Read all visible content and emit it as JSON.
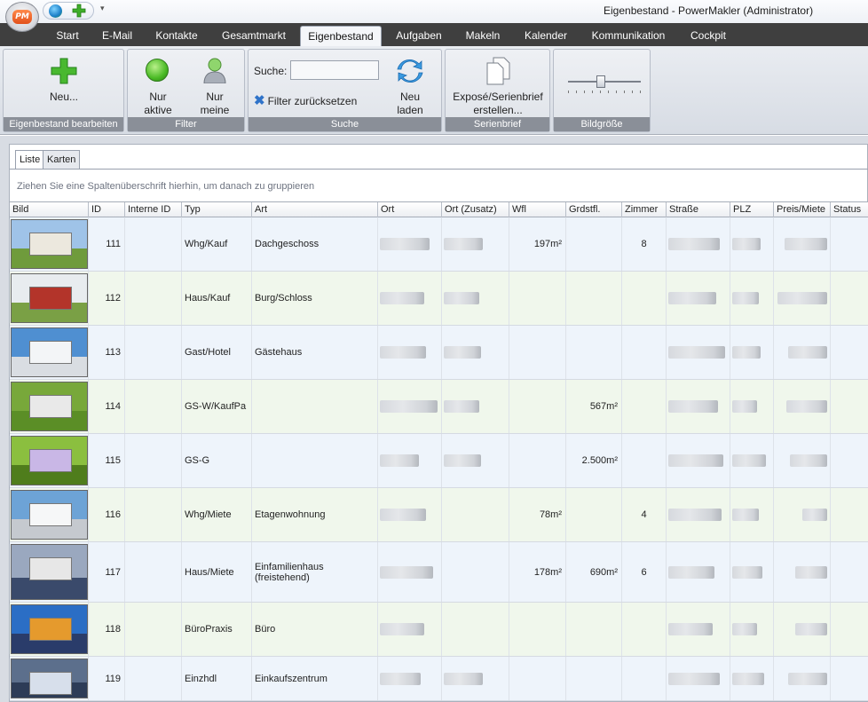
{
  "window": {
    "title": "Eigenbestand - PowerMakler (Administrator)",
    "logo_text": "PM"
  },
  "qat": {
    "icons": [
      "globe-icon",
      "plus-icon"
    ],
    "dropdown": "▾"
  },
  "tabs": [
    "Start",
    "E-Mail",
    "Kontakte",
    "Gesamtmarkt",
    "Eigenbestand",
    "Aufgaben",
    "Makeln",
    "Kalender",
    "Kommunikation",
    "Cockpit"
  ],
  "active_tab": "Eigenbestand",
  "ribbon": {
    "groups": {
      "eigenbestand": {
        "caption": "Eigenbestand bearbeiten",
        "new_label": "Neu..."
      },
      "filter": {
        "caption": "Filter",
        "active_label_1": "Nur",
        "active_label_2": "aktive",
        "mine_label_1": "Nur",
        "mine_label_2": "meine"
      },
      "suche": {
        "caption": "Suche",
        "search_label": "Suche:",
        "search_value": "",
        "reset_label": "Filter zurücksetzen",
        "reload_label_1": "Neu",
        "reload_label_2": "laden"
      },
      "serienbrief": {
        "caption": "Serienbrief",
        "expose_label_1": "Exposé/Serienbrief",
        "expose_label_2": "erstellen..."
      },
      "bildgroesse": {
        "caption": "Bildgröße",
        "value": 0.45
      }
    }
  },
  "view_tabs": [
    "Liste",
    "Karten"
  ],
  "group_hint": "Ziehen Sie eine Spaltenüberschrift hierhin, um danach zu gruppieren",
  "columns": [
    "Bild",
    "ID",
    "Interne ID",
    "Typ",
    "Art",
    "Ort",
    "Ort (Zusatz)",
    "Wfl",
    "Grdstfl.",
    "Zimmer",
    "Straße",
    "PLZ",
    "Preis/Miete",
    "Status"
  ],
  "rows": [
    {
      "id": "111",
      "interne_id": "",
      "typ": "Whg/Kauf",
      "art": "Dachgeschoss",
      "wfl": "197m²",
      "grdstfl": "",
      "zimmer": "8",
      "thumb": "apartment-house"
    },
    {
      "id": "112",
      "interne_id": "",
      "typ": "Haus/Kauf",
      "art": "Burg/Schloss",
      "wfl": "",
      "grdstfl": "",
      "zimmer": "",
      "thumb": "modern-house"
    },
    {
      "id": "113",
      "interne_id": "",
      "typ": "Gast/Hotel",
      "art": "Gästehaus",
      "wfl": "",
      "grdstfl": "",
      "zimmer": "",
      "thumb": "high-rise"
    },
    {
      "id": "114",
      "interne_id": "",
      "typ": "GS-W/KaufPa",
      "art": "",
      "wfl": "",
      "grdstfl": "567m²",
      "zimmer": "",
      "thumb": "garden"
    },
    {
      "id": "115",
      "interne_id": "",
      "typ": "GS-G",
      "art": "",
      "wfl": "",
      "grdstfl": "2.500m²",
      "zimmer": "",
      "thumb": "garden-table"
    },
    {
      "id": "116",
      "interne_id": "",
      "typ": "Whg/Miete",
      "art": "Etagenwohnung",
      "wfl": "78m²",
      "grdstfl": "",
      "zimmer": "4",
      "thumb": "apartment-block"
    },
    {
      "id": "117",
      "interne_id": "",
      "typ": "Haus/Miete",
      "art": "Einfamilienhaus (freistehend)",
      "wfl": "178m²",
      "grdstfl": "690m²",
      "zimmer": "6",
      "thumb": "villa"
    },
    {
      "id": "118",
      "interne_id": "",
      "typ": "BüroPraxis",
      "art": "Büro",
      "wfl": "",
      "grdstfl": "",
      "zimmer": "",
      "thumb": "office"
    },
    {
      "id": "119",
      "interne_id": "",
      "typ": "Einzhdl",
      "art": "Einkaufszentrum",
      "wfl": "",
      "grdstfl": "",
      "zimmer": "",
      "thumb": "mall"
    }
  ],
  "colors": {
    "tabbar": "#3f3f3f",
    "group_caption": "#8a8f98",
    "row_even": "#f0f7ec",
    "row_odd": "#eef4fb",
    "accent_green": "#3fae2a",
    "accent_blue": "#2f73c9"
  }
}
